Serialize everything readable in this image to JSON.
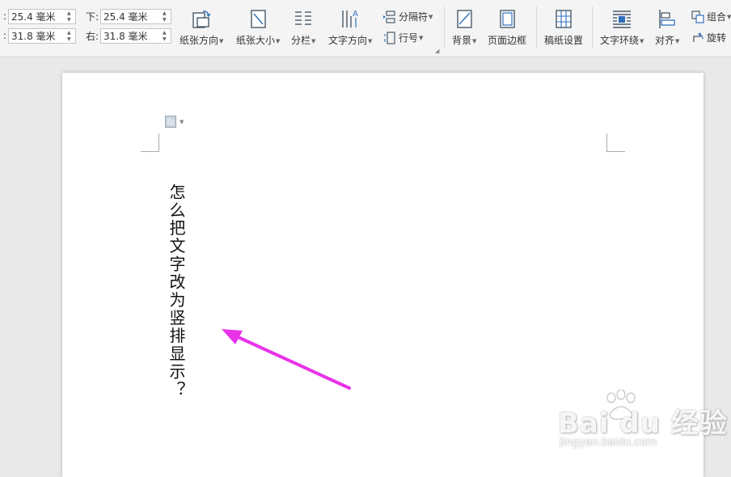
{
  "margins": {
    "top": {
      "label": "",
      "value": "25.4 毫米"
    },
    "bottom": {
      "label": "下:",
      "value": "25.4 毫米"
    },
    "left": {
      "label": "",
      "value": "31.8 毫米"
    },
    "right": {
      "label": "右:",
      "value": "31.8 毫米"
    }
  },
  "toolbar": {
    "orientation": "纸张方向",
    "size": "纸张大小",
    "columns": "分栏",
    "text_direction": "文字方向",
    "breaks": "分隔符",
    "line_numbers": "行号",
    "background": "背景",
    "page_border": "页面边框",
    "manuscript": "稿纸设置",
    "text_wrap": "文字环绕",
    "align": "对齐",
    "group": "组合",
    "rotate": "旋转"
  },
  "document": {
    "text": "怎么把文字改为竖排显示？"
  },
  "watermark": {
    "brand": "Bai du 经验",
    "url": "jingyan.baidu.com"
  },
  "colors": {
    "arrow": "#e833e8",
    "icon": "#4a5a6a",
    "accent": "#2f6fbd"
  }
}
